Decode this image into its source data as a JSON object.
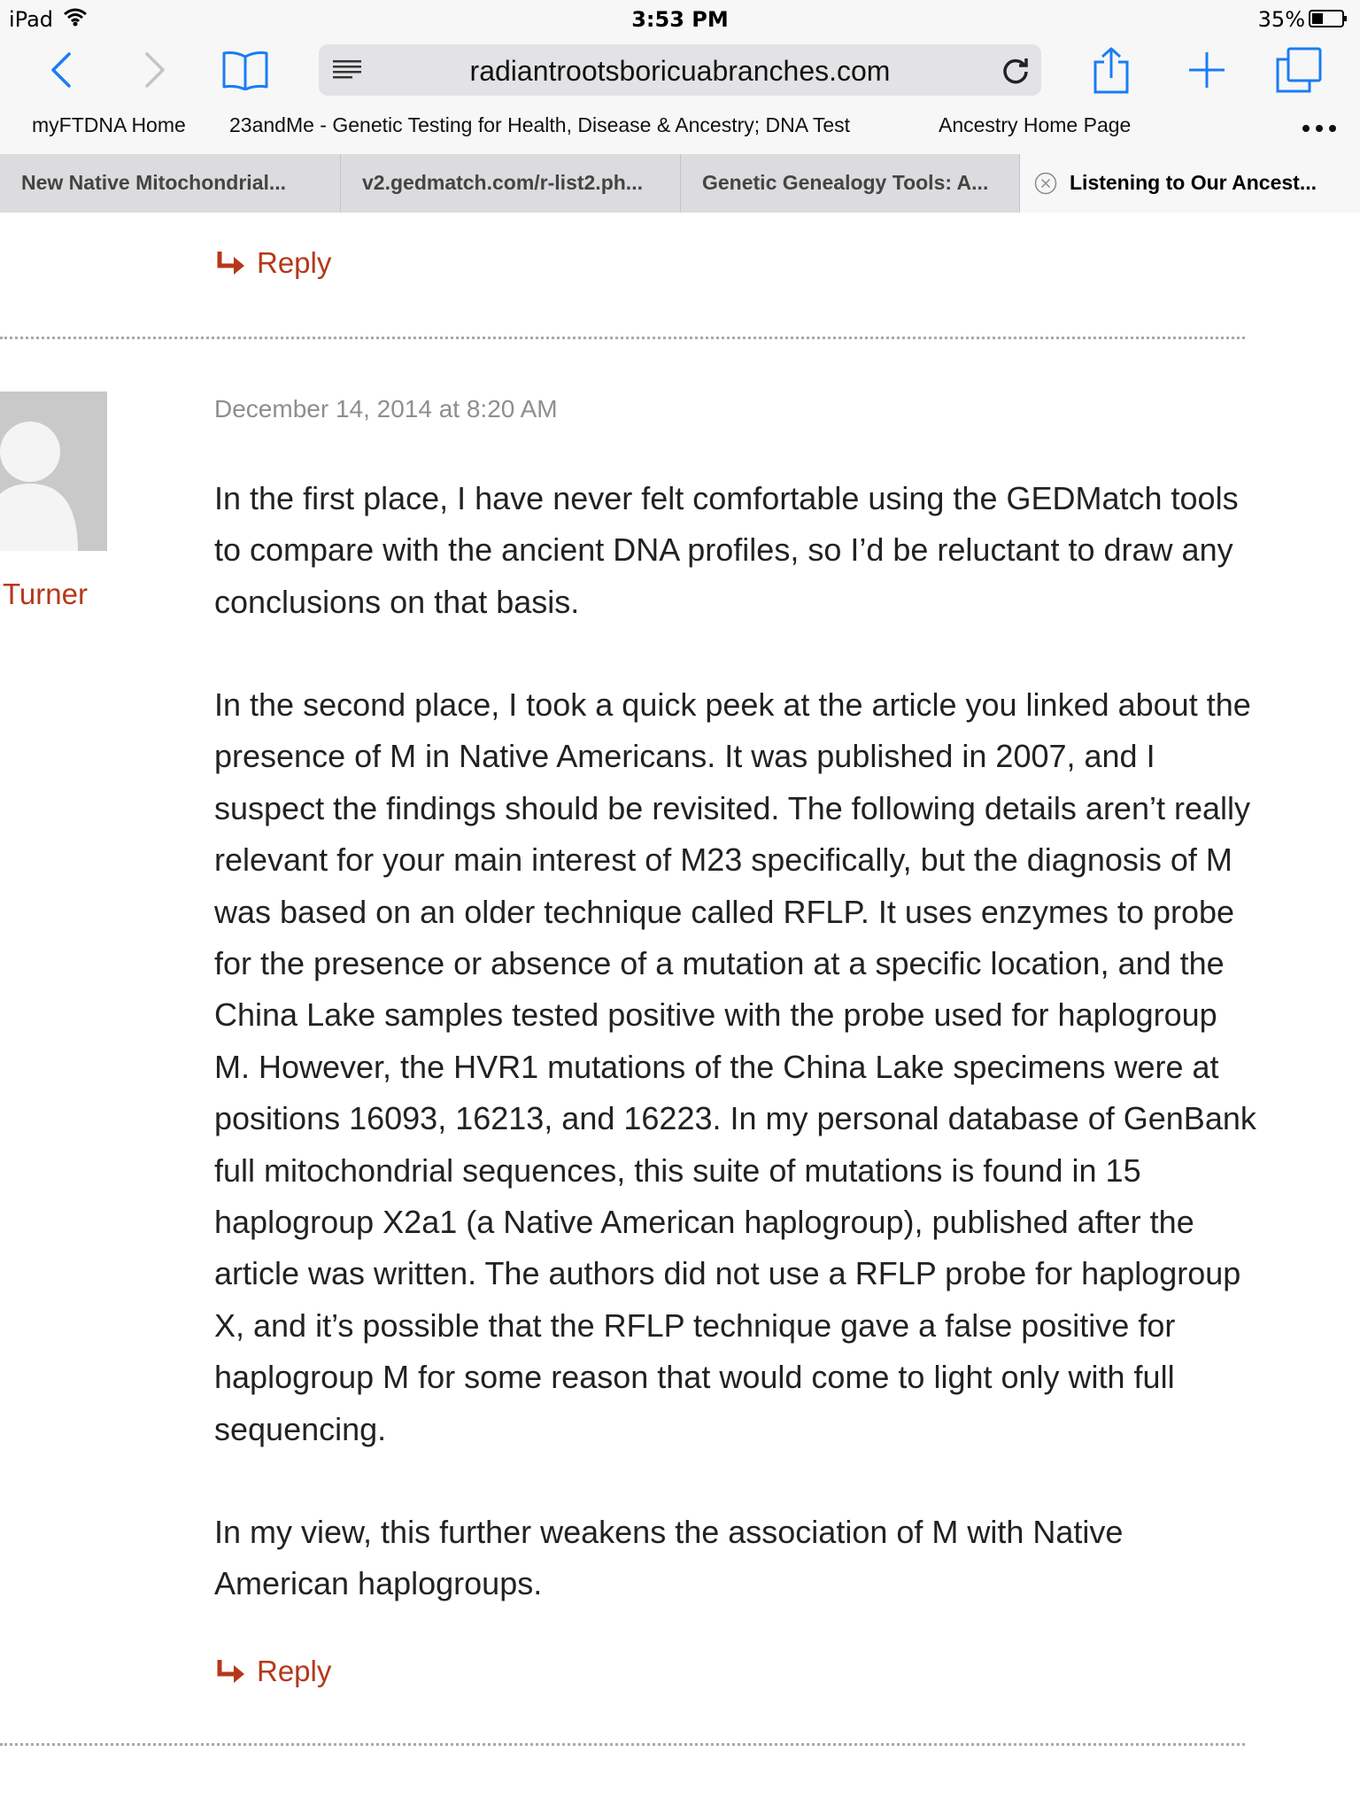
{
  "status_bar": {
    "device": "iPad",
    "time": "3:53 PM",
    "battery": "35%"
  },
  "toolbar": {
    "url": "radiantrootsboricuabranches.com"
  },
  "bookmarks": [
    "myFTDNA Home",
    "23andMe - Genetic Testing for Health, Disease & Ancestry; DNA Test",
    "Ancestry Home Page"
  ],
  "tabs": [
    "New Native Mitochondrial...",
    "v2.gedmatch.com/r-list2.ph...",
    "Genetic Genealogy Tools: A...",
    "Listening to Our Ancest..."
  ],
  "colors": {
    "accent": "#b5381a",
    "ios_blue": "#1a7cf5"
  },
  "reply_label": "Reply",
  "comment": {
    "author": "Turner",
    "date": "December 14, 2014 at 8:20 AM",
    "paragraphs": [
      "In the first place, I have never felt comfortable using the GEDMatch tools to compare with the ancient DNA profiles, so I’d be reluctant to draw any conclusions on that basis.",
      "In the second place, I took a quick peek at the article you linked about the presence of M in Native Americans. It was published in 2007, and I suspect the findings should be revisited. The following details aren’t really relevant for your main interest of M23 specifically, but the diagnosis of M was based on an older technique called RFLP. It uses enzymes to probe for the presence or absence of a mutation at a specific location, and the China Lake samples tested positive with the probe used for haplogroup M. However, the HVR1 mutations of the China Lake specimens were at positions 16093, 16213, and 16223. In my personal database of GenBank full mitochondrial sequences, this suite of mutations is found in 15 haplogroup X2a1 (a Native American haplogroup), published after the article was written. The authors did not use a RFLP probe for haplogroup X, and it’s possible that the RFLP technique gave a false positive for haplogroup M for some reason that would come to light only with full sequencing.",
      "In my view, this further weakens the association of M with Native American haplogroups."
    ]
  }
}
